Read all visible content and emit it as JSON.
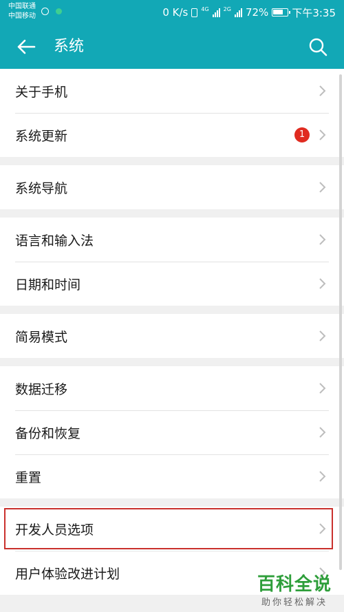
{
  "status_bar": {
    "carrier_1": "中国联通",
    "carrier_2": "中国移动",
    "net_speed": "0 K/s",
    "net_4g": "4G",
    "net_2g": "2G",
    "battery": "72%",
    "time": "下午3:35"
  },
  "app_bar": {
    "title": "系统",
    "back_icon": "back-arrow-icon",
    "search_icon": "search-icon"
  },
  "colors": {
    "accent": "#12a8b6",
    "badge": "#e02b20",
    "highlight": "#c9302c"
  },
  "groups": [
    {
      "items": [
        {
          "label": "关于手机"
        },
        {
          "label": "系统更新",
          "badge": "1"
        }
      ]
    },
    {
      "items": [
        {
          "label": "系统导航"
        }
      ]
    },
    {
      "items": [
        {
          "label": "语言和输入法"
        },
        {
          "label": "日期和时间"
        }
      ]
    },
    {
      "items": [
        {
          "label": "简易模式"
        }
      ]
    },
    {
      "items": [
        {
          "label": "数据迁移"
        },
        {
          "label": "备份和恢复"
        },
        {
          "label": "重置"
        }
      ]
    },
    {
      "items": [
        {
          "label": "开发人员选项"
        },
        {
          "label": "用户体验改进计划"
        }
      ]
    }
  ],
  "watermark": {
    "main": "百科全说",
    "sub": "助你轻松解决"
  }
}
